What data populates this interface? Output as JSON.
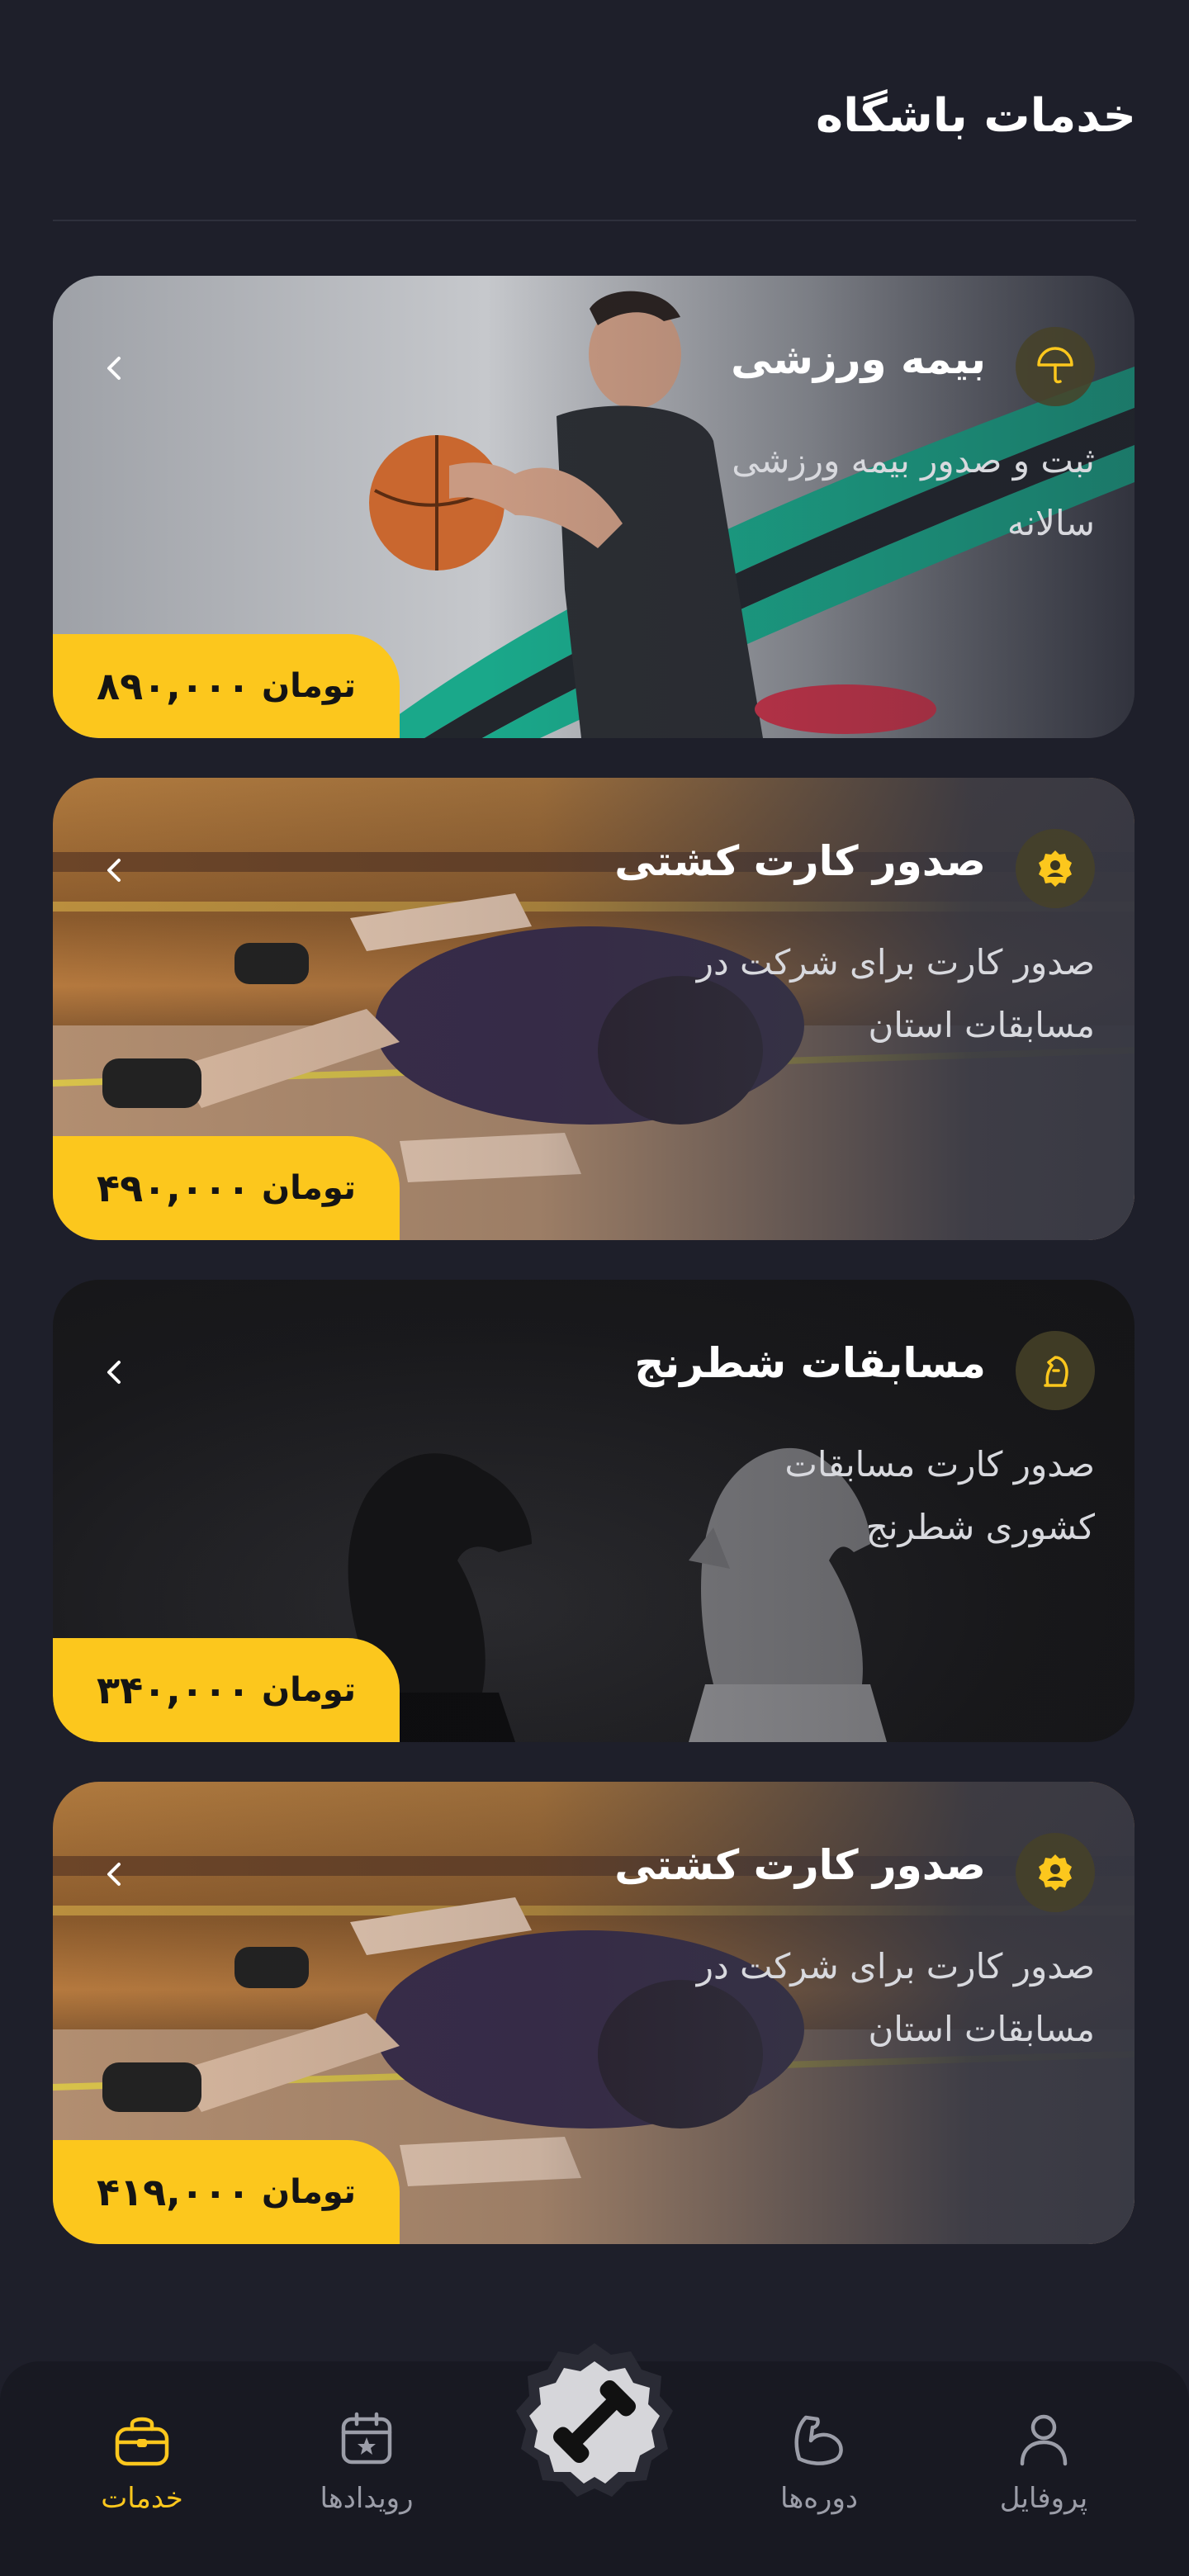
{
  "header": {
    "title": "خدمات باشگاه"
  },
  "cards": [
    {
      "title": "بیمه ورزشی",
      "description": "ثبت و صدور بیمه ورزشی سالانه",
      "price": "۸۹۰,۰۰۰",
      "currency": "تومان",
      "icon": "umbrella-icon"
    },
    {
      "title": "صدور کارت کشتی",
      "description": "صدور کارت برای شرکت در مسابقات استان",
      "price": "۴۹۰,۰۰۰",
      "currency": "تومان",
      "icon": "medal-icon"
    },
    {
      "title": "مسابقات شطرنج",
      "description": "صدور کارت مسابقات کشوری شطرنج",
      "price": "۳۴۰,۰۰۰",
      "currency": "تومان",
      "icon": "chess-knight-icon"
    },
    {
      "title": "صدور کارت کشتی",
      "description": "صدور کارت برای شرکت در مسابقات استان",
      "price": "۴۱۹,۰۰۰",
      "currency": "تومان",
      "icon": "medal-icon"
    }
  ],
  "nav": {
    "items": [
      {
        "label": "خدمات",
        "icon": "bag-icon",
        "active": true
      },
      {
        "label": "رویدادها",
        "icon": "calendar-icon",
        "active": false
      },
      {
        "label": "دوره‌ها",
        "icon": "muscle-icon",
        "active": false
      },
      {
        "label": "پروفایل",
        "icon": "user-icon",
        "active": false
      }
    ],
    "center_icon": "dumbbell-icon"
  },
  "colors": {
    "accent": "#fcc71d",
    "background": "#1e1f2a",
    "nav_background": "#181922"
  }
}
